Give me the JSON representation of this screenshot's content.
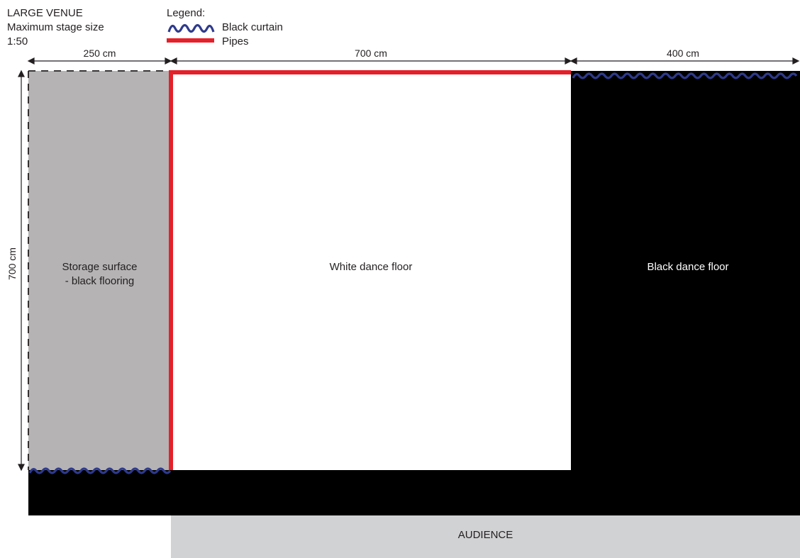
{
  "title": {
    "venue": "LARGE VENUE",
    "subtitle": "Maximum stage size",
    "scale": "1:50"
  },
  "legend": {
    "heading": "Legend:",
    "items": [
      {
        "symbol": "curtain-icon",
        "label": "Black curtain",
        "color": "#2e3a8c"
      },
      {
        "symbol": "pipe-icon",
        "label": "Pipes",
        "color": "#e4202a"
      }
    ]
  },
  "dimensions": {
    "storage_width": "250 cm",
    "white_floor_width": "700 cm",
    "black_floor_width": "400 cm",
    "depth": "700 cm"
  },
  "zones": {
    "storage": "Storage surface\n- black flooring",
    "white_floor": "White dance floor",
    "black_floor": "Black dance floor",
    "audience": "AUDIENCE"
  },
  "colors": {
    "storage_fill": "#b5b3b4",
    "black_floor": "#000000",
    "white_floor": "#ffffff",
    "audience_fill": "#d1d2d4",
    "pipe": "#e4202a",
    "curtain": "#2e3a8c",
    "line": "#231f20"
  }
}
